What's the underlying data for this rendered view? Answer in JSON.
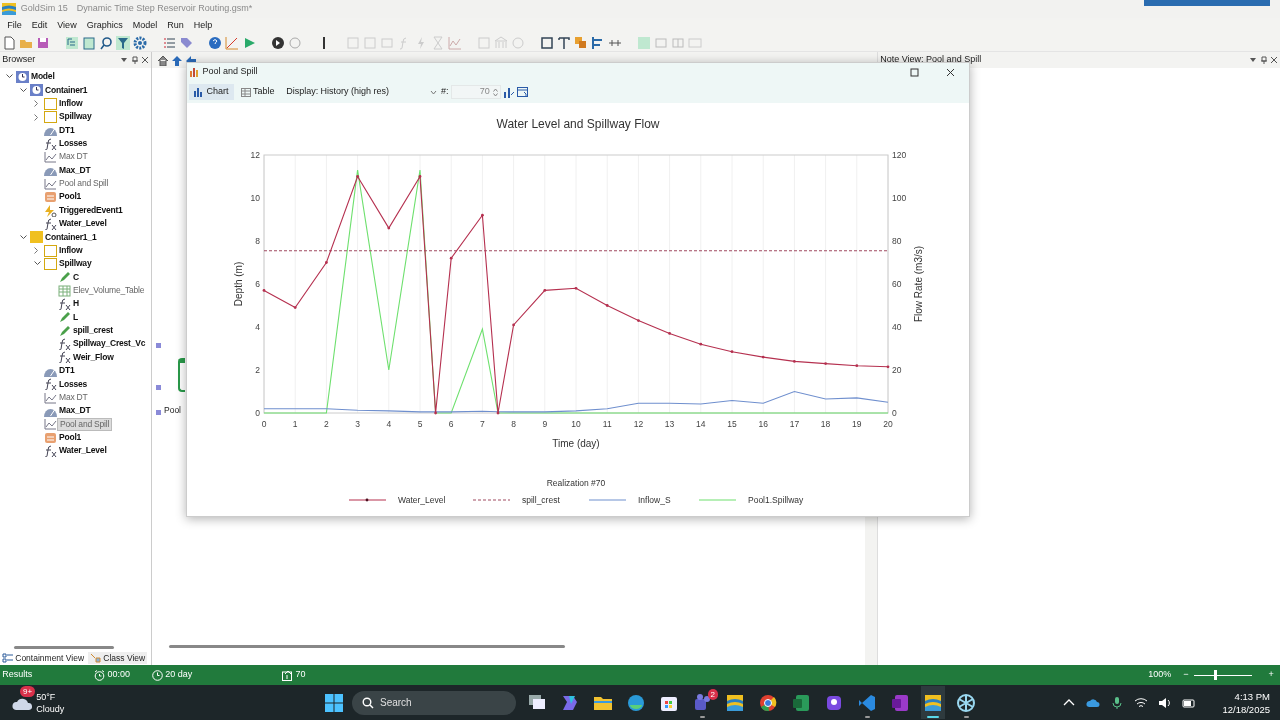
{
  "app": {
    "name": "GoldSim 15",
    "document": "Dynamic Time Step Reservoir Routing.gsm*"
  },
  "menu": [
    "File",
    "Edit",
    "View",
    "Graphics",
    "Model",
    "Run",
    "Help"
  ],
  "browser": {
    "title": "Browser",
    "tree": [
      {
        "label": "Model",
        "kind": "model",
        "bold": true,
        "selected": false,
        "expanded": true,
        "children": [
          {
            "label": "Container1",
            "kind": "model",
            "bold": true,
            "selected": false,
            "expanded": true,
            "children": [
              {
                "label": "Inflow",
                "kind": "container",
                "bold": true,
                "selected": false,
                "expanded": false
              },
              {
                "label": "Spillway",
                "kind": "container",
                "bold": true,
                "selected": false,
                "expanded": false
              },
              {
                "label": "DT1",
                "kind": "timer",
                "bold": true,
                "selected": false
              },
              {
                "label": "Losses",
                "kind": "function",
                "bold": true,
                "selected": false
              },
              {
                "label": "Max DT",
                "kind": "result",
                "bold": false,
                "selected": false
              },
              {
                "label": "Max_DT",
                "kind": "timer",
                "bold": true,
                "selected": false
              },
              {
                "label": "Pool and Spill",
                "kind": "result",
                "bold": false,
                "selected": false
              },
              {
                "label": "Pool1",
                "kind": "pool",
                "bold": true,
                "selected": false
              },
              {
                "label": "TriggeredEvent1",
                "kind": "event",
                "bold": true,
                "selected": false
              },
              {
                "label": "Water_Level",
                "kind": "function",
                "bold": true,
                "selected": false
              }
            ]
          },
          {
            "label": "Container1_1",
            "kind": "folder",
            "bold": true,
            "selected": false,
            "expanded": true,
            "children": [
              {
                "label": "Inflow",
                "kind": "container",
                "bold": true,
                "selected": false,
                "expanded": false
              },
              {
                "label": "Spillway",
                "kind": "container",
                "bold": true,
                "selected": false,
                "expanded": true,
                "children": [
                  {
                    "label": "C",
                    "kind": "data",
                    "bold": true,
                    "selected": false
                  },
                  {
                    "label": "Elev_Volume_Table",
                    "kind": "table",
                    "bold": false,
                    "selected": false
                  },
                  {
                    "label": "H",
                    "kind": "function",
                    "bold": true,
                    "selected": false
                  },
                  {
                    "label": "L",
                    "kind": "data",
                    "bold": true,
                    "selected": false
                  },
                  {
                    "label": "spill_crest",
                    "kind": "data",
                    "bold": true,
                    "selected": false
                  },
                  {
                    "label": "Spillway_Crest_Vc",
                    "kind": "function",
                    "bold": true,
                    "selected": false
                  },
                  {
                    "label": "Weir_Flow",
                    "kind": "function",
                    "bold": true,
                    "selected": false
                  }
                ]
              },
              {
                "label": "DT1",
                "kind": "timer",
                "bold": true,
                "selected": false
              },
              {
                "label": "Losses",
                "kind": "function",
                "bold": true,
                "selected": false
              },
              {
                "label": "Max DT",
                "kind": "result",
                "bold": false,
                "selected": false
              },
              {
                "label": "Max_DT",
                "kind": "timer",
                "bold": true,
                "selected": false
              },
              {
                "label": "Pool and Spill",
                "kind": "result",
                "bold": false,
                "selected": true
              },
              {
                "label": "Pool1",
                "kind": "pool",
                "bold": true,
                "selected": false
              },
              {
                "label": "Water_Level",
                "kind": "function",
                "bold": true,
                "selected": false
              }
            ]
          }
        ]
      }
    ],
    "tabs": [
      {
        "label": "Containment View",
        "selected": true
      },
      {
        "label": "Class View",
        "selected": false
      }
    ]
  },
  "canvas": {
    "element_label": "Pool"
  },
  "chart_window": {
    "title": "Pool and Spill",
    "tabs": [
      {
        "label": "Chart",
        "selected": true
      },
      {
        "label": "Table",
        "selected": false
      }
    ],
    "display_label": "Display:",
    "display_value": "History (high res)",
    "realization_label": "#:",
    "realization_value": "70",
    "chart_data": {
      "type": "line",
      "title": "Water Level and Spillway Flow",
      "xlabel": "Time (day)",
      "ylabel": "Depth (m)",
      "y2label": "Flow Rate (m3/s)",
      "legend": {
        "title": "Realization #70"
      },
      "grid": true,
      "x": [
        0,
        1,
        2,
        3,
        4,
        5,
        5.5,
        6,
        7,
        7.5,
        8,
        9,
        10,
        11,
        12,
        13,
        14,
        15,
        16,
        17,
        18,
        19,
        20
      ],
      "series": [
        {
          "name": "Water_Level",
          "color": "#b5304f",
          "values": [
            5.7,
            4.9,
            7.0,
            11.0,
            8.6,
            11.0,
            0,
            7.2,
            9.2,
            0,
            4.1,
            5.7,
            5.8,
            5.0,
            4.3,
            3.7,
            3.2,
            2.85,
            2.6,
            2.4,
            2.3,
            2.2,
            2.15
          ]
        },
        {
          "name": "spill_crest",
          "color": "#a04a60",
          "line_style": "dashed",
          "values": [
            7.55,
            7.55,
            7.55,
            7.55,
            7.55,
            7.55,
            7.55,
            7.55,
            7.55,
            7.55,
            7.55,
            7.55,
            7.55,
            7.55,
            7.55,
            7.55,
            7.55,
            7.55,
            7.55,
            7.55,
            7.55,
            7.55,
            7.55
          ]
        },
        {
          "name": "Inflow_S",
          "color": "#6f8fce",
          "axis": "y2",
          "values": [
            2,
            2,
            2,
            1.3,
            1,
            0.5,
            0.5,
            0.5,
            0.8,
            0.6,
            0.5,
            0.5,
            1,
            2,
            4.5,
            4.5,
            4.2,
            5.8,
            4.5,
            10,
            6.5,
            7,
            5
          ]
        },
        {
          "name": "Pool1.Spillway",
          "color": "#6ee06e",
          "axis": "y2",
          "values": [
            0,
            0,
            0,
            113,
            20,
            113,
            0,
            0,
            39,
            0,
            0,
            0,
            0,
            0,
            0,
            0,
            0,
            0,
            0,
            0,
            0,
            0,
            0
          ]
        }
      ],
      "xlim": [
        0,
        20
      ],
      "ylim": [
        0,
        12
      ],
      "y2lim": [
        0,
        120
      ],
      "xticks": [
        0,
        1,
        2,
        3,
        4,
        5,
        6,
        7,
        8,
        9,
        10,
        11,
        12,
        13,
        14,
        15,
        16,
        17,
        18,
        19,
        20
      ],
      "yticks": [
        0,
        2,
        4,
        6,
        8,
        10,
        12
      ],
      "y2ticks": [
        0,
        20,
        40,
        60,
        80,
        100,
        120
      ]
    }
  },
  "note_view": {
    "title": "Note View: Pool and Spill"
  },
  "status_bar": {
    "mode": "Results",
    "start": "00:00",
    "duration": "20 day",
    "realization": "70",
    "zoom": "100%",
    "zoom_out": "−",
    "zoom_in": "+",
    "zoom_slider": {
      "level": 0.37
    }
  },
  "taskbar": {
    "weather": {
      "badge": "9+",
      "temperature": "50°F",
      "condition": "Cloudy"
    },
    "search": {
      "placeholder": "Search"
    },
    "apps": [
      {
        "kind": "taskview",
        "running": false,
        "focused": false
      },
      {
        "kind": "copilot",
        "running": false,
        "focused": false
      },
      {
        "kind": "explorer",
        "running": false,
        "focused": false
      },
      {
        "kind": "edge",
        "running": false,
        "focused": false
      },
      {
        "kind": "store",
        "running": false,
        "focused": false
      },
      {
        "kind": "teams",
        "running": true,
        "focused": false,
        "badge": "2"
      },
      {
        "kind": "goldsim",
        "running": false,
        "focused": false
      },
      {
        "kind": "chrome",
        "running": false,
        "focused": false
      },
      {
        "kind": "excel",
        "running": false,
        "focused": false
      },
      {
        "kind": "purple",
        "running": false,
        "focused": false
      },
      {
        "kind": "vscode",
        "running": true,
        "focused": false
      },
      {
        "kind": "onenote",
        "running": false,
        "focused": false
      },
      {
        "kind": "goldsim",
        "running": true,
        "focused": true
      },
      {
        "kind": "snowflake",
        "running": true,
        "focused": false
      }
    ],
    "clock": {
      "time": "4:13 PM",
      "date": "12/18/2025"
    }
  }
}
